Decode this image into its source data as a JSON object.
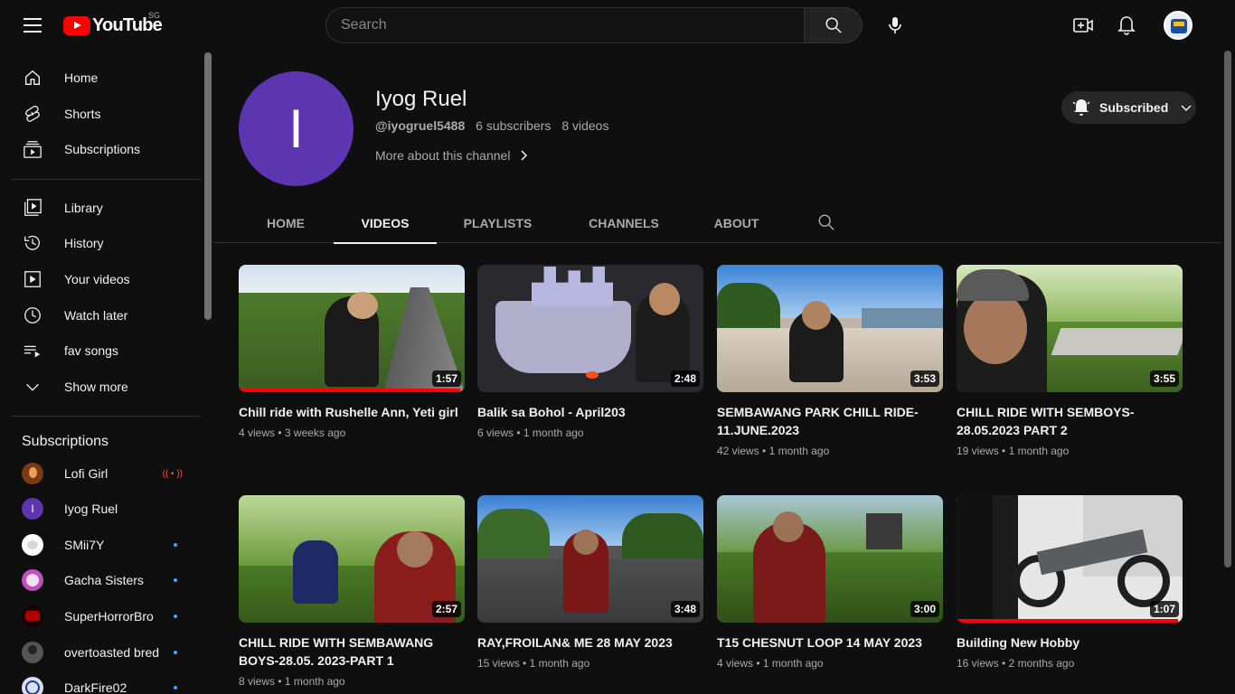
{
  "header": {
    "logo_text": "YouTube",
    "region": "SG",
    "search_placeholder": "Search"
  },
  "sidebar": {
    "main_items": [
      {
        "label": "Home",
        "icon": "home-icon"
      },
      {
        "label": "Shorts",
        "icon": "shorts-icon"
      },
      {
        "label": "Subscriptions",
        "icon": "subscriptions-icon"
      }
    ],
    "library_items": [
      {
        "label": "Library",
        "icon": "library-icon"
      },
      {
        "label": "History",
        "icon": "history-icon"
      },
      {
        "label": "Your videos",
        "icon": "your-videos-icon"
      },
      {
        "label": "Watch later",
        "icon": "watch-later-icon"
      },
      {
        "label": "fav songs",
        "icon": "playlist-icon"
      },
      {
        "label": "Show more",
        "icon": "chevron-down-icon"
      }
    ],
    "subscriptions_heading": "Subscriptions",
    "subscriptions": [
      {
        "name": "Lofi Girl",
        "status": "live",
        "color": "#7a3b12"
      },
      {
        "name": "Iyog Ruel",
        "status": "none",
        "color": "#5e35b1",
        "initial": "I"
      },
      {
        "name": "SMii7Y",
        "status": "dot",
        "color": "#ffffff"
      },
      {
        "name": "Gacha Sisters",
        "status": "dot",
        "color": "#c24fc2"
      },
      {
        "name": "SuperHorrorBro",
        "status": "dot",
        "color": "#b00000"
      },
      {
        "name": "overtoasted bred",
        "status": "dot",
        "color": "#555555"
      },
      {
        "name": "DarkFire02",
        "status": "dot",
        "color": "#dcdcf0"
      }
    ],
    "live_glyph": "(( • ))"
  },
  "channel": {
    "initial": "I",
    "name": "Iyog Ruel",
    "handle": "@iyogruel5488",
    "subscribers": "6 subscribers",
    "video_count": "8 videos",
    "more_about": "More about this channel",
    "subscribed_label": "Subscribed",
    "avatar_color": "#5e35b1"
  },
  "tabs": [
    {
      "label": "HOME",
      "active": false
    },
    {
      "label": "VIDEOS",
      "active": true
    },
    {
      "label": "PLAYLISTS",
      "active": false
    },
    {
      "label": "CHANNELS",
      "active": false
    },
    {
      "label": "ABOUT",
      "active": false
    }
  ],
  "videos": [
    {
      "title": "Chill ride with Rushelle Ann, Yeti girl",
      "views": "4 views",
      "age": "3 weeks ago",
      "duration": "1:57",
      "watched": 0.98
    },
    {
      "title": "Balik sa Bohol - April203",
      "views": "6 views",
      "age": "1 month ago",
      "duration": "2:48",
      "watched": 0
    },
    {
      "title": "SEMBAWANG PARK CHILL RIDE-11.JUNE.2023",
      "views": "42 views",
      "age": "1 month ago",
      "duration": "3:53",
      "watched": 0
    },
    {
      "title": "CHILL RIDE WITH SEMBOYS-28.05.2023 PART 2",
      "views": "19 views",
      "age": "1 month ago",
      "duration": "3:55",
      "watched": 0
    },
    {
      "title": "CHILL RIDE WITH SEMBAWANG BOYS-28.05. 2023-PART 1",
      "views": "8 views",
      "age": "1 month ago",
      "duration": "2:57",
      "watched": 0
    },
    {
      "title": "RAY,FROILAN& ME 28 MAY 2023",
      "views": "15 views",
      "age": "1 month ago",
      "duration": "3:48",
      "watched": 0
    },
    {
      "title": "T15 CHESNUT LOOP 14 MAY 2023",
      "views": "4 views",
      "age": "1 month ago",
      "duration": "3:00",
      "watched": 0
    },
    {
      "title": "Building New Hobby",
      "views": "16 views",
      "age": "2 months ago",
      "duration": "1:07",
      "watched": 0.98
    }
  ]
}
